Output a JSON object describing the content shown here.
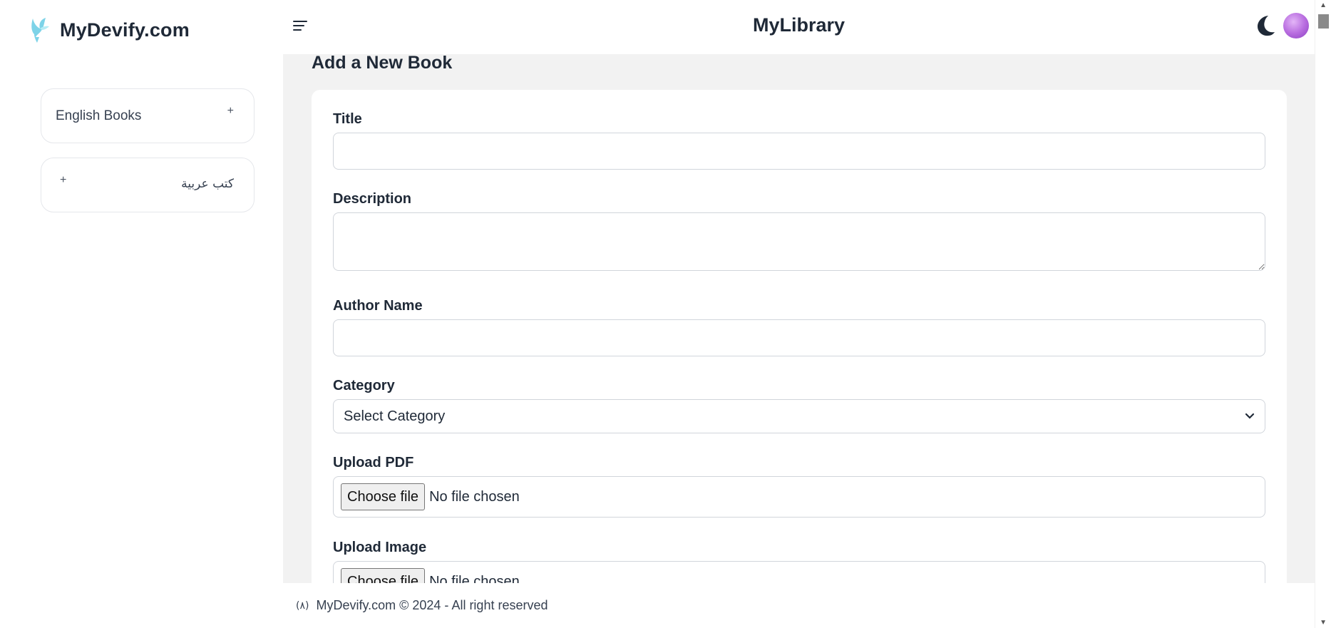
{
  "brand": {
    "name": "MyDevify.com",
    "logo_icon": "bird-logo-icon",
    "logo_color": "#7dd3e8"
  },
  "sidebar": {
    "items": [
      {
        "label": "English Books",
        "expand": "+"
      },
      {
        "label": "كتب عربية",
        "expand": "+"
      }
    ]
  },
  "header": {
    "title": "MyLibrary",
    "menu_icon": "hamburger-menu-icon",
    "theme_icon": "moon-icon",
    "avatar_color": "#b96ee0"
  },
  "main": {
    "heading": "Add a New Book",
    "background": "#f2f2f2"
  },
  "form": {
    "title": {
      "label": "Title",
      "value": ""
    },
    "description": {
      "label": "Description",
      "value": ""
    },
    "author": {
      "label": "Author Name",
      "value": ""
    },
    "category": {
      "label": "Category",
      "selected": "Select Category"
    },
    "pdf": {
      "label": "Upload PDF",
      "button": "Choose file",
      "status": "No file chosen"
    },
    "image": {
      "label": "Upload Image",
      "button": "Choose file",
      "status": "No file chosen"
    }
  },
  "footer": {
    "mark": "(۸)",
    "text": "MyDevify.com © 2024 - All right reserved"
  }
}
